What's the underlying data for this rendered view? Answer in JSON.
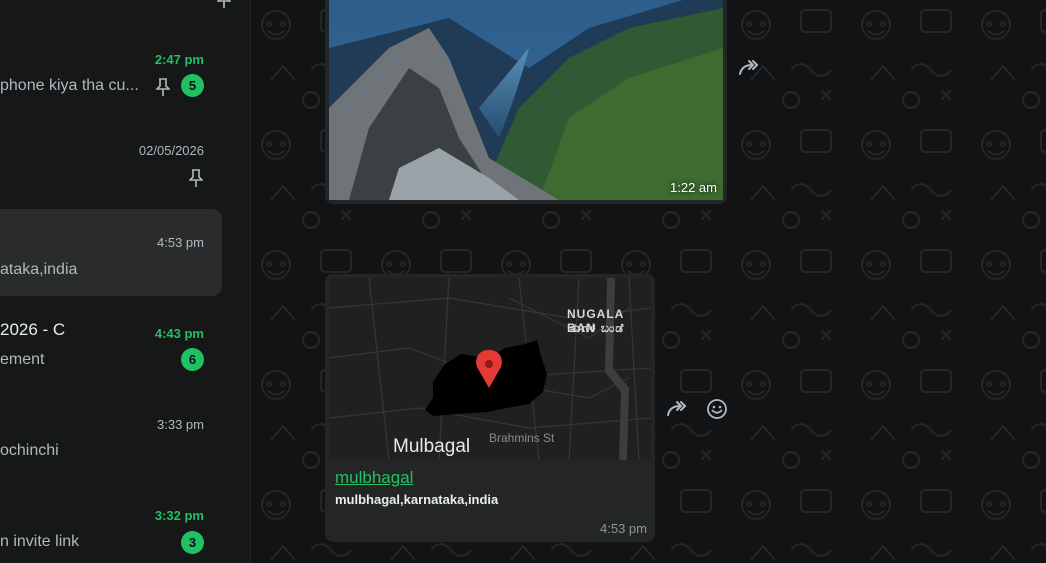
{
  "chat_list": [
    {
      "time": "2:47 pm",
      "time_unread": true,
      "preview": "phone kiya tha cu...",
      "pinned": true,
      "unread_count": "5"
    },
    {
      "time": "02/05/2026",
      "time_unread": false,
      "pinned": true
    },
    {
      "time": "4:53 pm",
      "time_unread": false,
      "preview": "ataka,india",
      "selected": true
    },
    {
      "time": "4:43 pm",
      "time_unread": true,
      "title": "2026 - C",
      "preview": "ement",
      "unread_count": "6"
    },
    {
      "time": "3:33 pm",
      "time_unread": false,
      "preview": "ochinchi"
    },
    {
      "time": "3:32 pm",
      "time_unread": true,
      "preview": "n invite link",
      "unread_count": "3"
    }
  ],
  "messages": {
    "image": {
      "time": "1:22 am"
    },
    "location": {
      "name": "mulbhagal",
      "address": "mulbhagal,karnataka,india",
      "time": "4:53 pm",
      "map_labels": {
        "city": "Mulbagal",
        "street": "Brahmins St",
        "area_en": "NUGALA BAN",
        "area_local": "ನುಗಳ ಬಂಡೆ"
      }
    }
  },
  "icons": {
    "forward": "forward-arrow-icon",
    "emoji": "smiley-icon",
    "pin": "pin-icon"
  },
  "colors": {
    "accent": "#21c063",
    "sidebar_bg": "#161717",
    "bubble_bg": "#242626",
    "map_pin": "#e53935"
  }
}
